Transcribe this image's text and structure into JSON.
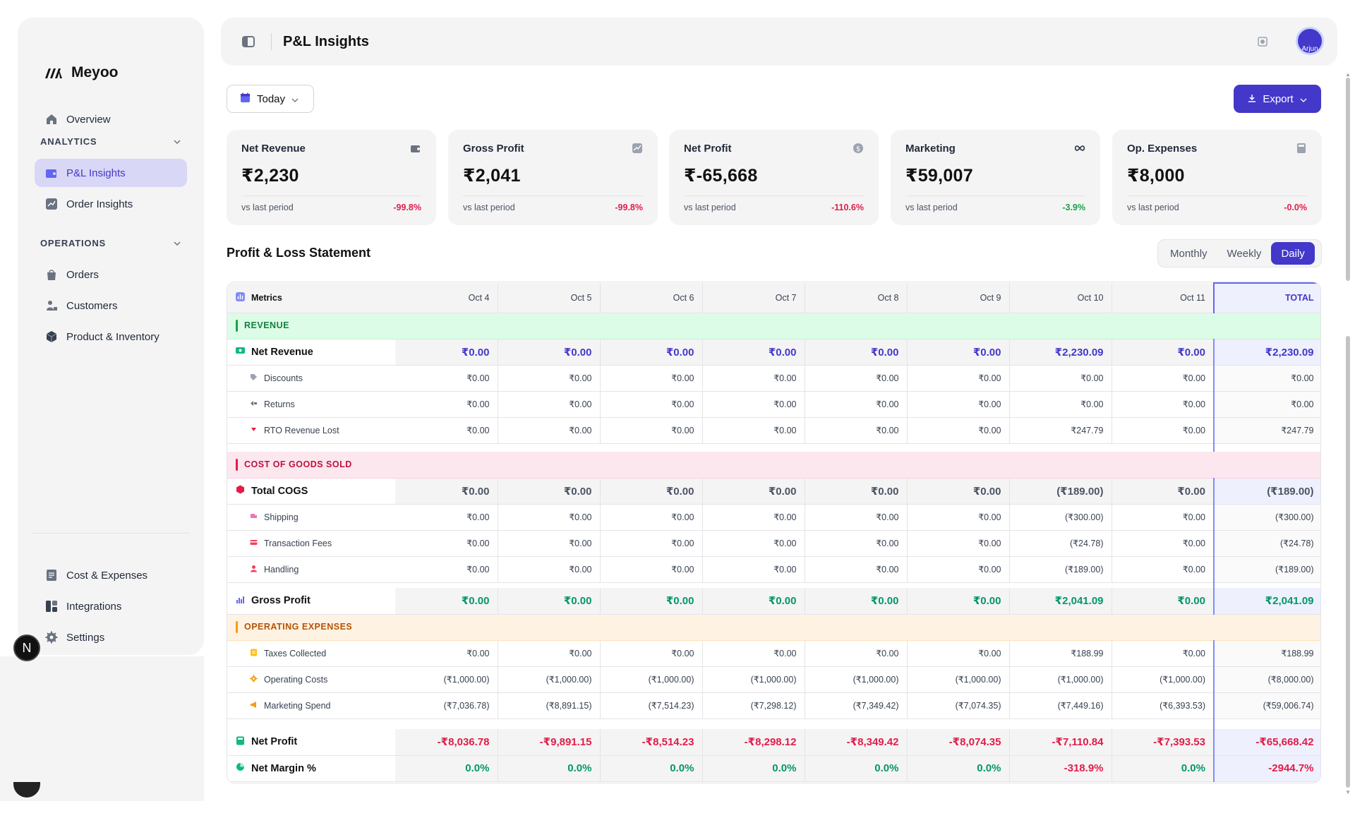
{
  "brand": {
    "name": "Meyoo"
  },
  "sidebar": {
    "overview": "Overview",
    "analytics_section": "ANALYTICS",
    "pl_insights": "P&L Insights",
    "order_insights": "Order Insights",
    "operations_section": "OPERATIONS",
    "orders": "Orders",
    "customers": "Customers",
    "product_inventory": "Product & Inventory",
    "cost_expenses": "Cost & Expenses",
    "integrations": "Integrations",
    "settings": "Settings",
    "next_badge": "N"
  },
  "header": {
    "title": "P&L Insights",
    "avatar_text": "Arjun"
  },
  "toolbar": {
    "date_label": "Today",
    "export_label": "Export"
  },
  "colors": {
    "accent": "#4338ca",
    "negative": "#e11d48",
    "positive": "#16a34a"
  },
  "kpis": [
    {
      "label": "Net Revenue",
      "icon": "wallet-icon",
      "value": "₹2,230",
      "sub": "vs last period",
      "change": "-99.8%"
    },
    {
      "label": "Gross Profit",
      "icon": "trend-chart-icon",
      "value": "₹2,041",
      "sub": "vs last period",
      "change": "-99.8%"
    },
    {
      "label": "Net Profit",
      "icon": "dollar-coin-icon",
      "value": "₹-65,668",
      "sub": "vs last period",
      "change": "-110.6%"
    },
    {
      "label": "Marketing",
      "icon": "infinity-icon",
      "value": "₹59,007",
      "sub": "vs last period",
      "change": "-3.9%"
    },
    {
      "label": "Op. Expenses",
      "icon": "calculator-icon",
      "value": "₹8,000",
      "sub": "vs last period",
      "change": "-0.0%"
    }
  ],
  "statement": {
    "title": "Profit & Loss Statement",
    "tabs": [
      "Monthly",
      "Weekly",
      "Daily"
    ],
    "active_tab": "Daily",
    "metrics_header": "Metrics",
    "columns": [
      "Oct 4",
      "Oct 5",
      "Oct 6",
      "Oct 7",
      "Oct 8",
      "Oct 9",
      "Oct 10",
      "Oct 11"
    ],
    "total_header": "TOTAL",
    "sections": {
      "revenue": "REVENUE",
      "cogs": "COST OF GOODS SOLD",
      "opex": "OPERATING EXPENSES"
    },
    "rows": {
      "net_revenue": {
        "label": "Net Revenue",
        "values": [
          "₹0.00",
          "₹0.00",
          "₹0.00",
          "₹0.00",
          "₹0.00",
          "₹0.00",
          "₹2,230.09",
          "₹0.00"
        ],
        "total": "₹2,230.09"
      },
      "discounts": {
        "label": "Discounts",
        "values": [
          "₹0.00",
          "₹0.00",
          "₹0.00",
          "₹0.00",
          "₹0.00",
          "₹0.00",
          "₹0.00",
          "₹0.00"
        ],
        "total": "₹0.00"
      },
      "returns": {
        "label": "Returns",
        "values": [
          "₹0.00",
          "₹0.00",
          "₹0.00",
          "₹0.00",
          "₹0.00",
          "₹0.00",
          "₹0.00",
          "₹0.00"
        ],
        "total": "₹0.00"
      },
      "rto": {
        "label": "RTO Revenue Lost",
        "values": [
          "₹0.00",
          "₹0.00",
          "₹0.00",
          "₹0.00",
          "₹0.00",
          "₹0.00",
          "₹247.79",
          "₹0.00"
        ],
        "total": "₹247.79"
      },
      "total_cogs": {
        "label": "Total COGS",
        "values": [
          "₹0.00",
          "₹0.00",
          "₹0.00",
          "₹0.00",
          "₹0.00",
          "₹0.00",
          "(₹189.00)",
          "₹0.00"
        ],
        "total": "(₹189.00)"
      },
      "shipping": {
        "label": "Shipping",
        "values": [
          "₹0.00",
          "₹0.00",
          "₹0.00",
          "₹0.00",
          "₹0.00",
          "₹0.00",
          "(₹300.00)",
          "₹0.00"
        ],
        "total": "(₹300.00)"
      },
      "transaction_fees": {
        "label": "Transaction Fees",
        "values": [
          "₹0.00",
          "₹0.00",
          "₹0.00",
          "₹0.00",
          "₹0.00",
          "₹0.00",
          "(₹24.78)",
          "₹0.00"
        ],
        "total": "(₹24.78)"
      },
      "handling": {
        "label": "Handling",
        "values": [
          "₹0.00",
          "₹0.00",
          "₹0.00",
          "₹0.00",
          "₹0.00",
          "₹0.00",
          "(₹189.00)",
          "₹0.00"
        ],
        "total": "(₹189.00)"
      },
      "gross_profit": {
        "label": "Gross Profit",
        "values": [
          "₹0.00",
          "₹0.00",
          "₹0.00",
          "₹0.00",
          "₹0.00",
          "₹0.00",
          "₹2,041.09",
          "₹0.00"
        ],
        "total": "₹2,041.09"
      },
      "taxes_collected": {
        "label": "Taxes Collected",
        "values": [
          "₹0.00",
          "₹0.00",
          "₹0.00",
          "₹0.00",
          "₹0.00",
          "₹0.00",
          "₹188.99",
          "₹0.00"
        ],
        "total": "₹188.99"
      },
      "operating_costs": {
        "label": "Operating Costs",
        "values": [
          "(₹1,000.00)",
          "(₹1,000.00)",
          "(₹1,000.00)",
          "(₹1,000.00)",
          "(₹1,000.00)",
          "(₹1,000.00)",
          "(₹1,000.00)",
          "(₹1,000.00)"
        ],
        "total": "(₹8,000.00)"
      },
      "marketing_spend": {
        "label": "Marketing Spend",
        "values": [
          "(₹7,036.78)",
          "(₹8,891.15)",
          "(₹7,514.23)",
          "(₹7,298.12)",
          "(₹7,349.42)",
          "(₹7,074.35)",
          "(₹7,449.16)",
          "(₹6,393.53)"
        ],
        "total": "(₹59,006.74)"
      },
      "net_profit": {
        "label": "Net Profit",
        "values": [
          "-₹8,036.78",
          "-₹9,891.15",
          "-₹8,514.23",
          "-₹8,298.12",
          "-₹8,349.42",
          "-₹8,074.35",
          "-₹7,110.84",
          "-₹7,393.53"
        ],
        "total": "-₹65,668.42"
      },
      "net_margin": {
        "label": "Net Margin %",
        "values": [
          "0.0%",
          "0.0%",
          "0.0%",
          "0.0%",
          "0.0%",
          "0.0%",
          "-318.9%",
          "0.0%"
        ],
        "total": "-2944.7%"
      }
    }
  }
}
